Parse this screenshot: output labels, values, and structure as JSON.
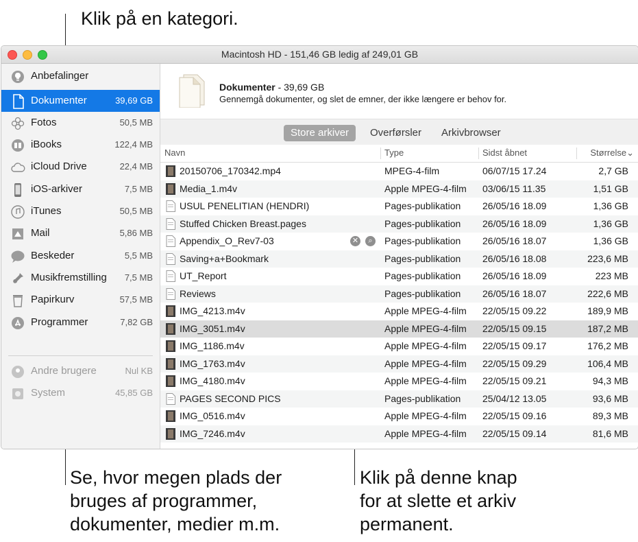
{
  "callouts": {
    "top": "Klik på en kategori.",
    "left_lines": [
      "Se, hvor megen plads der",
      "bruges af programmer,",
      "dokumenter, medier m.m."
    ],
    "right_lines": [
      "Klik på denne knap",
      "for at slette et arkiv",
      "permanent."
    ]
  },
  "window": {
    "title": "Macintosh HD - 151,46 GB ledig af 249,01 GB"
  },
  "sidebar": {
    "items": [
      {
        "label": "Anbefalinger",
        "size": "",
        "icon": "lightbulb-icon"
      },
      {
        "label": "Dokumenter",
        "size": "39,69 GB",
        "icon": "document-icon",
        "selected": true
      },
      {
        "label": "Fotos",
        "size": "50,5 MB",
        "icon": "photos-icon"
      },
      {
        "label": "iBooks",
        "size": "122,4 MB",
        "icon": "book-icon"
      },
      {
        "label": "iCloud Drive",
        "size": "22,4 MB",
        "icon": "cloud-icon"
      },
      {
        "label": "iOS-arkiver",
        "size": "7,5 MB",
        "icon": "iphone-icon"
      },
      {
        "label": "iTunes",
        "size": "50,5 MB",
        "icon": "music-note-icon"
      },
      {
        "label": "Mail",
        "size": "5,86 MB",
        "icon": "mail-stamp-icon"
      },
      {
        "label": "Beskeder",
        "size": "5,5 MB",
        "icon": "chat-bubble-icon"
      },
      {
        "label": "Musikfremstilling",
        "size": "7,5 MB",
        "icon": "guitar-icon"
      },
      {
        "label": "Papirkurv",
        "size": "57,5 MB",
        "icon": "trash-icon"
      },
      {
        "label": "Programmer",
        "size": "7,82 GB",
        "icon": "app-store-icon"
      }
    ],
    "other": [
      {
        "label": "Andre brugere",
        "size": "Nul KB",
        "icon": "users-icon"
      },
      {
        "label": "System",
        "size": "45,85 GB",
        "icon": "system-disk-icon"
      }
    ]
  },
  "header": {
    "title": "Dokumenter",
    "size": "- 39,69 GB",
    "description": "Gennemgå dokumenter, og slet de emner, der ikke længere er behov for."
  },
  "tabs": [
    "Store arkiver",
    "Overførsler",
    "Arkivbrowser"
  ],
  "columns": {
    "name": "Navn",
    "type": "Type",
    "opened": "Sidst åbnet",
    "size": "Størrelse"
  },
  "rows": [
    {
      "name": "20150706_170342.mp4",
      "type": "MPEG-4-film",
      "opened": "06/07/15 17.24",
      "size": "2,7 GB"
    },
    {
      "name": "Media_1.m4v",
      "type": "Apple MPEG-4-film",
      "opened": "03/06/15 11.35",
      "size": "1,51 GB"
    },
    {
      "name": "USUL PENELITIAN (HENDRI)",
      "type": "Pages-publikation",
      "opened": "26/05/16 18.09",
      "size": "1,36 GB"
    },
    {
      "name": "Stuffed Chicken Breast.pages",
      "type": "Pages-publikation",
      "opened": "26/05/16 18.09",
      "size": "1,36 GB"
    },
    {
      "name": "Appendix_O_Rev7-03",
      "type": "Pages-publikation",
      "opened": "26/05/16 18.07",
      "size": "1,36 GB"
    },
    {
      "name": "Saving+a+Bookmark",
      "type": "Pages-publikation",
      "opened": "26/05/16 18.08",
      "size": "223,6 MB"
    },
    {
      "name": "UT_Report",
      "type": "Pages-publikation",
      "opened": "26/05/16 18.09",
      "size": "223 MB"
    },
    {
      "name": "Reviews",
      "type": "Pages-publikation",
      "opened": "26/05/16 18.07",
      "size": "222,6 MB"
    },
    {
      "name": "IMG_4213.m4v",
      "type": "Apple MPEG-4-film",
      "opened": "22/05/15 09.22",
      "size": "189,9 MB"
    },
    {
      "name": "IMG_3051.m4v",
      "type": "Apple MPEG-4-film",
      "opened": "22/05/15 09.15",
      "size": "187,2 MB"
    },
    {
      "name": "IMG_1186.m4v",
      "type": "Apple MPEG-4-film",
      "opened": "22/05/15 09.17",
      "size": "176,2 MB"
    },
    {
      "name": "IMG_1763.m4v",
      "type": "Apple MPEG-4-film",
      "opened": "22/05/15 09.29",
      "size": "106,4 MB"
    },
    {
      "name": "IMG_4180.m4v",
      "type": "Apple MPEG-4-film",
      "opened": "22/05/15 09.21",
      "size": "94,3 MB"
    },
    {
      "name": "PAGES SECOND PICS",
      "type": "Pages-publikation",
      "opened": "25/04/12 13.05",
      "size": "93,6 MB"
    },
    {
      "name": "IMG_0516.m4v",
      "type": "Apple MPEG-4-film",
      "opened": "22/05/15 09.16",
      "size": "89,3 MB"
    },
    {
      "name": "IMG_7246.m4v",
      "type": "Apple MPEG-4-film",
      "opened": "22/05/15 09.14",
      "size": "81,6 MB"
    }
  ],
  "row_buttons": {
    "delete": "✕",
    "reveal": "⌕"
  },
  "sort_glyph": "⌄",
  "colors": {
    "selection": "#1479e6",
    "close": "#fc5753",
    "minimize": "#fdbc40",
    "zoom": "#33c748"
  }
}
